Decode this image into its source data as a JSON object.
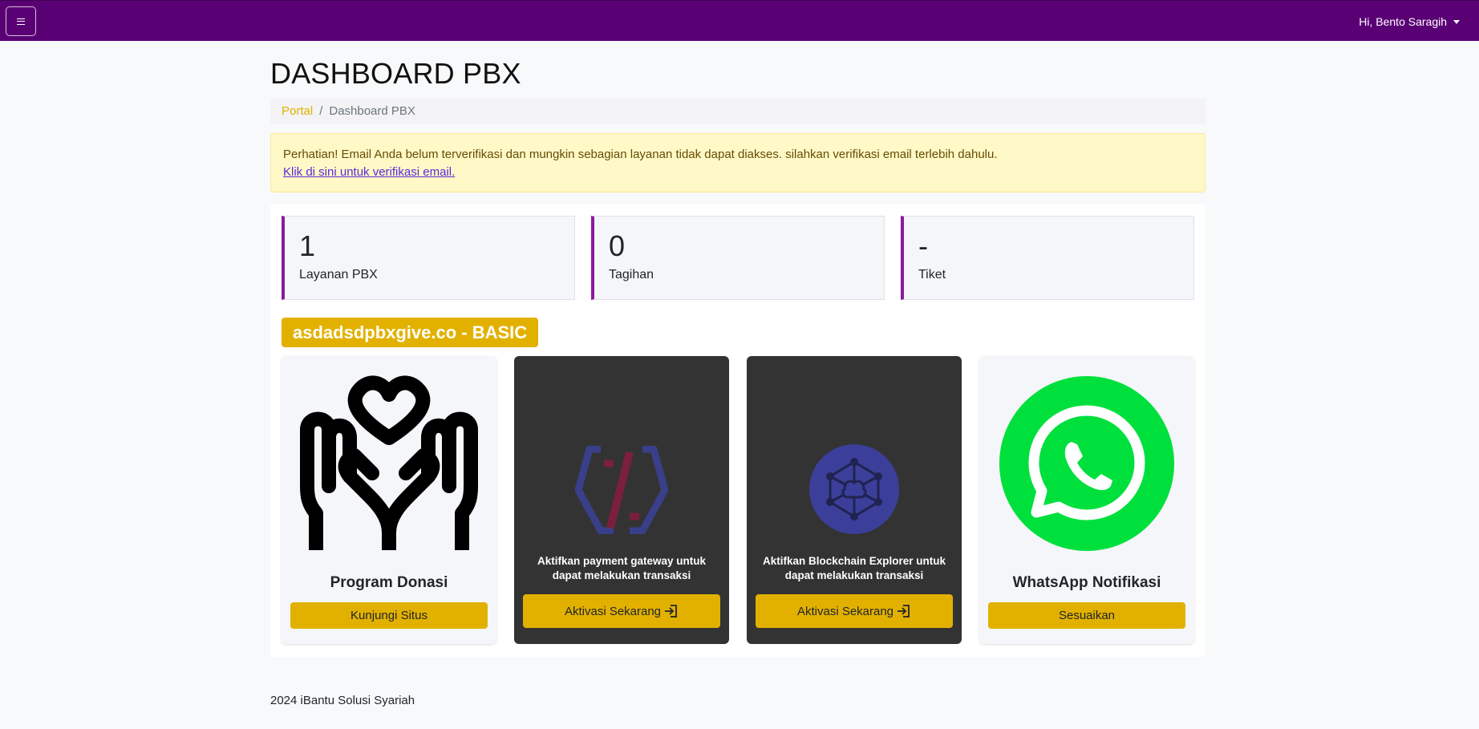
{
  "header": {
    "user_greeting": "Hi, Bento Saragih"
  },
  "page": {
    "title": "DASHBOARD PBX"
  },
  "breadcrumb": {
    "items": [
      {
        "label": "Portal"
      },
      {
        "label": "Dashboard PBX"
      }
    ]
  },
  "alert": {
    "message": "Perhatian! Email Anda belum terverifikasi dan mungkin sebagian layanan tidak dapat diakses. silahkan verifikasi email terlebih dahulu.",
    "link_text": "Klik di sini untuk verifikasi email."
  },
  "stats": [
    {
      "value": "1",
      "label": "Layanan PBX"
    },
    {
      "value": "0",
      "label": "Tagihan"
    },
    {
      "value": "-",
      "label": "Tiket"
    }
  ],
  "domain_badge": "asdadsdpbxgive.co - BASIC",
  "cards": [
    {
      "title": "Program Donasi",
      "button": "Kunjungi Situs",
      "icon": "donation-hands-heart-icon"
    },
    {
      "text": "Aktifkan payment gateway untuk dapat melakukan transaksi",
      "button": "Aktivasi Sekarang",
      "icon": "payment-gateway-icon"
    },
    {
      "text": "Aktifkan Blockchain Explorer untuk dapat melakukan transaksi",
      "button": "Aktivasi Sekarang",
      "icon": "blockchain-network-icon"
    },
    {
      "title": "WhatsApp Notifikasi",
      "button": "Sesuaikan",
      "icon": "whatsapp-icon"
    }
  ],
  "footer": {
    "text": "2024 iBantu Solusi Syariah"
  },
  "colors": {
    "topbar": "#5a0075",
    "accent": "#e2b100",
    "stat_border": "#8a1a9c",
    "dark_card": "#333333",
    "whatsapp": "#00e03c"
  }
}
